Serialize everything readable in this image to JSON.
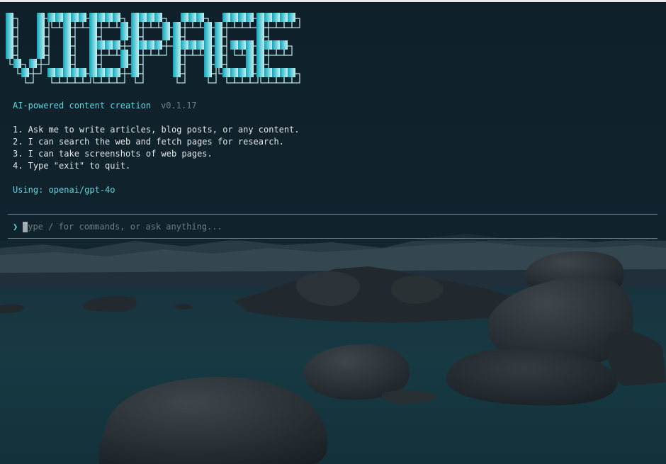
{
  "banner": {
    "logo_text": "VIBPAGE",
    "gradient_start": "#0aa8bd",
    "gradient_end": "#c6f0f2"
  },
  "header": {
    "subtitle": "AI-powered content creation",
    "version": "v0.1.17"
  },
  "instructions": [
    "1. Ask me to write articles, blog posts, or any content.",
    "2. I can search the web and fetch pages for research.",
    "3. I can take screenshots of web pages.",
    "4. Type \"exit\" to quit."
  ],
  "model": {
    "label": "Using: openai/gpt-4o"
  },
  "prompt": {
    "symbol": "❯",
    "value": "",
    "placeholder": "Type / for commands, or ask anything..."
  },
  "colors": {
    "accent": "#5fd7e0",
    "text": "#e3e8ea",
    "muted": "#6e7f88",
    "background_overlay": "#132733"
  },
  "background": {
    "description_icon": "lake-rocks-mountains-wallpaper"
  }
}
